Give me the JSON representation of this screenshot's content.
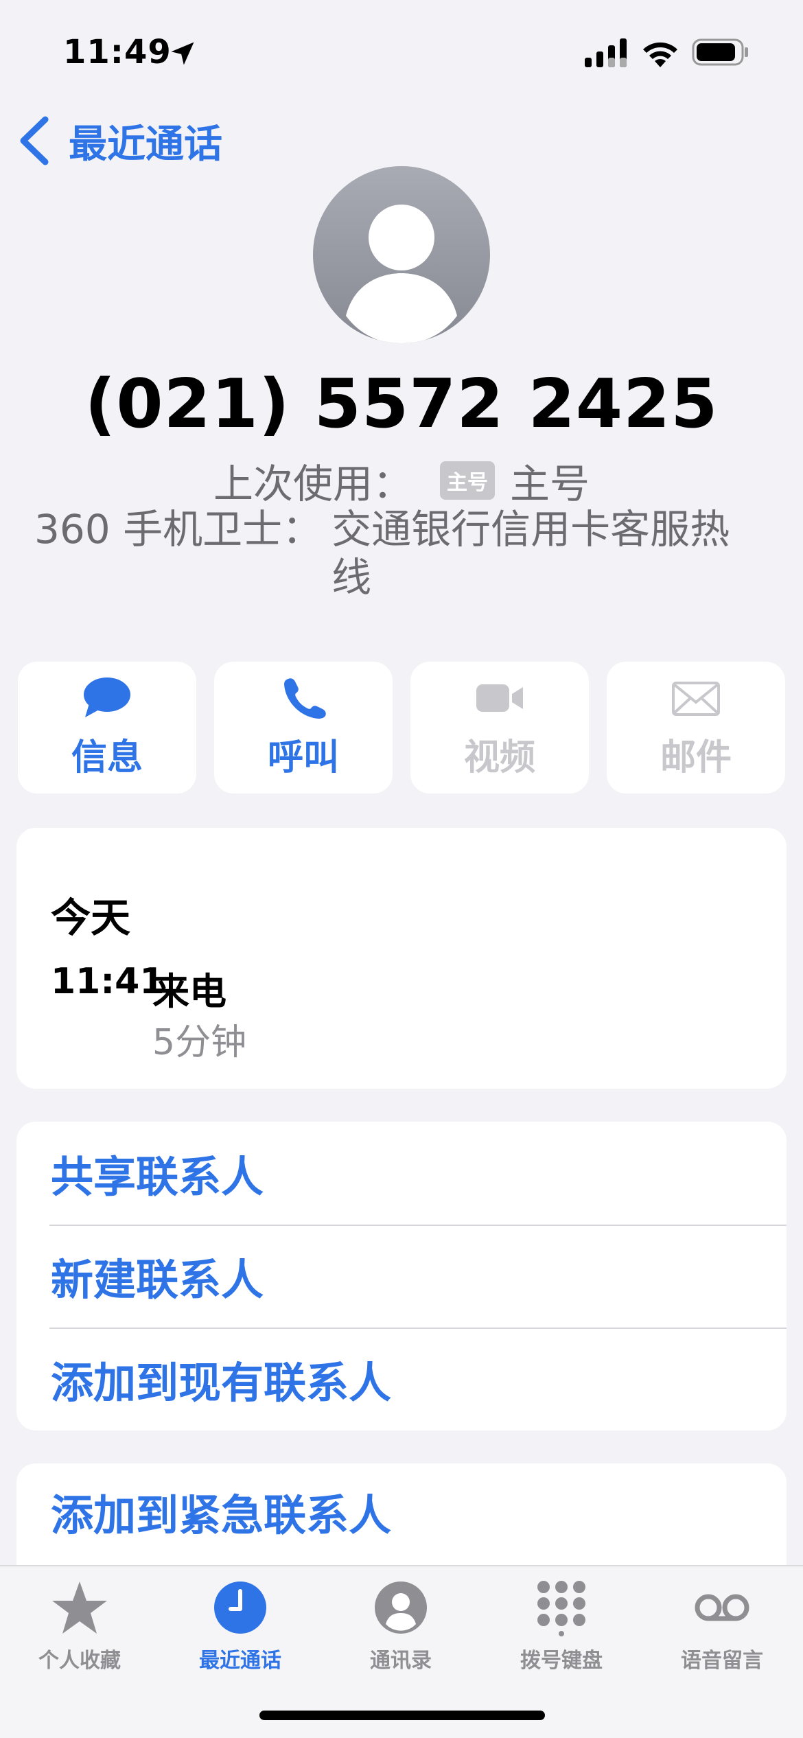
{
  "status_bar": {
    "time": "11:49",
    "icons": [
      "location-arrow-icon",
      "cellular-signal-icon",
      "wifi-icon",
      "battery-icon"
    ]
  },
  "nav": {
    "back_label": "最近通话",
    "back_icon": "chevron-left-icon"
  },
  "contact": {
    "avatar_icon": "person-silhouette-icon",
    "phone_number": "(021) 5572 2425",
    "last_used_label": "上次使用：",
    "sim_badge": "主号",
    "sim_name": "主号",
    "caller_id_label": "360 手机卫士：",
    "caller_id_value": "交通银行信用卡客服热线"
  },
  "actions": [
    {
      "label": "信息",
      "icon": "message-bubble-icon",
      "enabled": true
    },
    {
      "label": "呼叫",
      "icon": "phone-icon",
      "enabled": true
    },
    {
      "label": "视频",
      "icon": "video-camera-icon",
      "enabled": false
    },
    {
      "label": "邮件",
      "icon": "envelope-icon",
      "enabled": false
    }
  ],
  "history": {
    "date": "今天",
    "time": "11:41",
    "type": "来电",
    "duration": "5分钟"
  },
  "contact_actions": [
    {
      "label": "共享联系人"
    },
    {
      "label": "新建联系人"
    },
    {
      "label": "添加到现有联系人"
    }
  ],
  "emergency": {
    "label": "添加到紧急联系人"
  },
  "tab_bar": [
    {
      "label": "个人收藏",
      "icon": "star-icon",
      "active": false
    },
    {
      "label": "最近通话",
      "icon": "clock-icon",
      "active": true
    },
    {
      "label": "通讯录",
      "icon": "person-circle-icon",
      "active": false
    },
    {
      "label": "拨号键盘",
      "icon": "keypad-icon",
      "active": false
    },
    {
      "label": "语音留言",
      "icon": "voicemail-icon",
      "active": false
    }
  ],
  "colors": {
    "accent": "#2f74e6",
    "background": "#f2f2f7",
    "secondary_text": "#6b6b70",
    "disabled": "#c7c7cc"
  }
}
